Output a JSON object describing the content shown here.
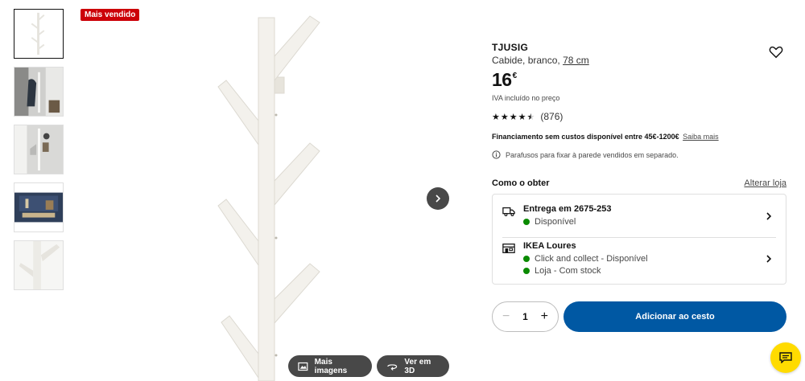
{
  "badge": "Mais vendido",
  "gallery": {
    "thumbnails": [
      "product-photo",
      "hallway-coats",
      "hallway-white",
      "living-room",
      "product-detail"
    ],
    "more_images_label": "Mais imagens",
    "view_3d_label": "Ver em 3D"
  },
  "product": {
    "name": "TJUSIG",
    "description": "Cabide, branco,",
    "size_link": "78 cm",
    "price": "16",
    "currency": "€",
    "vat_note": "IVA incluído no preço",
    "rating_value": 4.5,
    "rating_count": "(876)",
    "finance_text": "Financiamento sem custos disponível entre 45€-1200€",
    "finance_link": "Saiba mais",
    "notice": "Parafusos para fixar à parede vendidos em separado."
  },
  "fulfillment": {
    "heading": "Como o obter",
    "change_store": "Alterar loja",
    "delivery": {
      "title": "Entrega em 2675-253",
      "status": "Disponível"
    },
    "store": {
      "title": "IKEA Loures",
      "line1": "Click and collect - Disponível",
      "line2": "Loja - Com stock"
    }
  },
  "cart": {
    "quantity": "1",
    "add_label": "Adicionar ao cesto"
  },
  "colors": {
    "brand_blue": "#0058a3",
    "badge_red": "#cc0008",
    "available_green": "#0a8a00",
    "chat_yellow": "#ffdb00"
  }
}
